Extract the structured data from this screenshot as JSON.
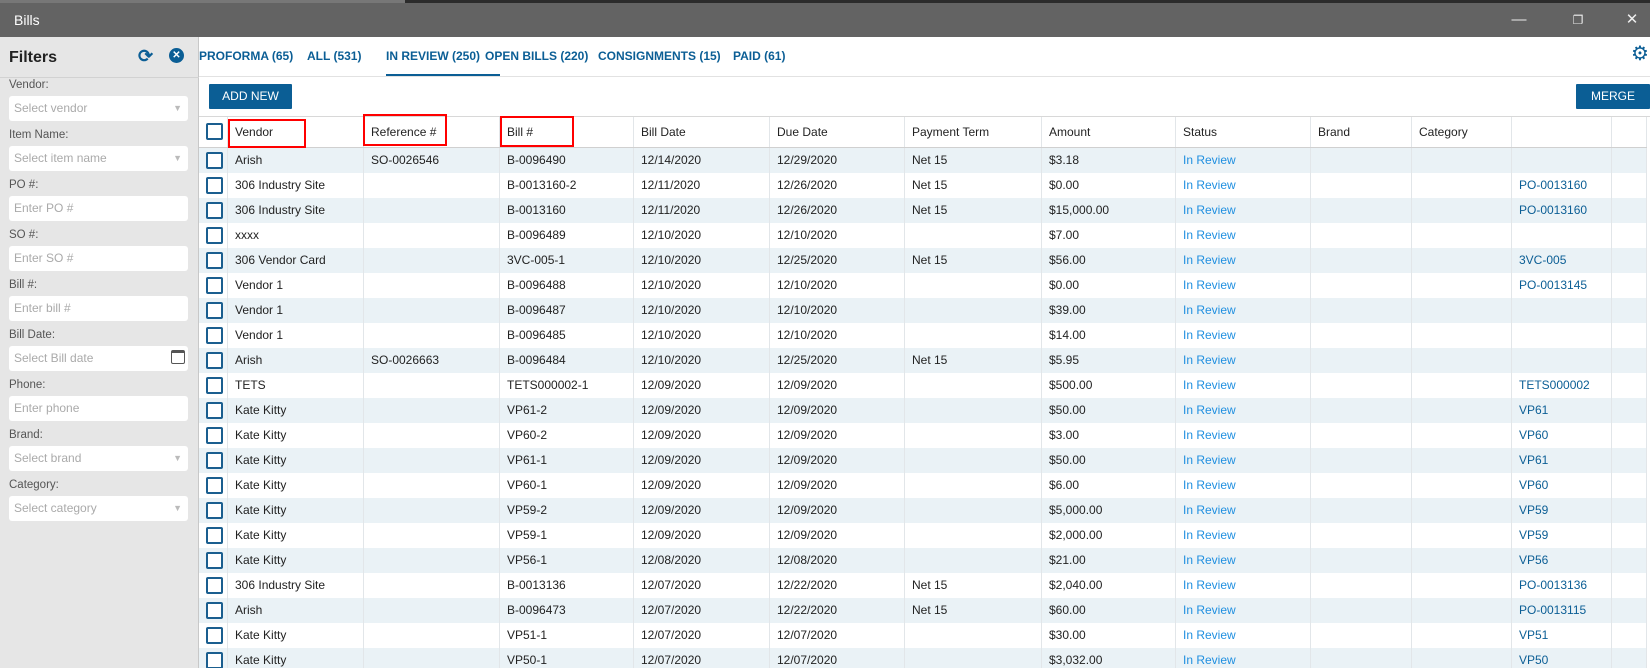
{
  "window": {
    "title": "Bills",
    "minimize": "—",
    "restore": "❐",
    "close": "✕"
  },
  "filters": {
    "title": "Filters",
    "refresh_icon": "⟳",
    "clear_icon": "✕",
    "fields": [
      {
        "label": "Vendor:",
        "placeholder": "Select vendor",
        "type": "select"
      },
      {
        "label": "Item Name:",
        "placeholder": "Select item name",
        "type": "select"
      },
      {
        "label": "PO #:",
        "placeholder": "Enter PO #",
        "type": "text"
      },
      {
        "label": "SO #:",
        "placeholder": "Enter SO #",
        "type": "text"
      },
      {
        "label": "Bill #:",
        "placeholder": "Enter bill #",
        "type": "text"
      },
      {
        "label": "Bill Date:",
        "placeholder": "Select Bill date",
        "type": "date"
      },
      {
        "label": "Phone:",
        "placeholder": "Enter phone",
        "type": "text"
      },
      {
        "label": "Brand:",
        "placeholder": "Select brand",
        "type": "select"
      },
      {
        "label": "Category:",
        "placeholder": "Select category",
        "type": "select"
      }
    ]
  },
  "tabs": [
    {
      "label": "PROFORMA (65)"
    },
    {
      "label": "ALL (531)"
    },
    {
      "label": "IN REVIEW (250)",
      "active": true
    },
    {
      "label": "OPEN BILLS (220)"
    },
    {
      "label": "CONSIGNMENTS (15)"
    },
    {
      "label": "PAID (61)"
    }
  ],
  "toolbar": {
    "add_new": "ADD NEW",
    "merge": "MERGE",
    "settings_icon": "⚙"
  },
  "table": {
    "headers": [
      "Vendor",
      "Reference #",
      "Bill #",
      "Bill Date",
      "Due Date",
      "Payment Term",
      "Amount",
      "Status",
      "Brand",
      "Category",
      "",
      ""
    ],
    "rows": [
      [
        "Arish",
        "SO-0026546",
        "B-0096490",
        "12/14/2020",
        "12/29/2020",
        "Net 15",
        "$3.18",
        "In Review",
        "",
        "",
        ""
      ],
      [
        "306 Industry Site",
        "",
        "B-0013160-2",
        "12/11/2020",
        "12/26/2020",
        "Net 15",
        "$0.00",
        "In Review",
        "",
        "",
        "PO-0013160"
      ],
      [
        "306 Industry Site",
        "",
        "B-0013160",
        "12/11/2020",
        "12/26/2020",
        "Net 15",
        "$15,000.00",
        "In Review",
        "",
        "",
        "PO-0013160"
      ],
      [
        "xxxx",
        "",
        "B-0096489",
        "12/10/2020",
        "12/10/2020",
        "",
        "$7.00",
        "In Review",
        "",
        "",
        ""
      ],
      [
        "306 Vendor Card",
        "",
        "3VC-005-1",
        "12/10/2020",
        "12/25/2020",
        "Net 15",
        "$56.00",
        "In Review",
        "",
        "",
        "3VC-005"
      ],
      [
        "Vendor 1",
        "",
        "B-0096488",
        "12/10/2020",
        "12/10/2020",
        "",
        "$0.00",
        "In Review",
        "",
        "",
        "PO-0013145"
      ],
      [
        "Vendor 1",
        "",
        "B-0096487",
        "12/10/2020",
        "12/10/2020",
        "",
        "$39.00",
        "In Review",
        "",
        "",
        ""
      ],
      [
        "Vendor 1",
        "",
        "B-0096485",
        "12/10/2020",
        "12/10/2020",
        "",
        "$14.00",
        "In Review",
        "",
        "",
        ""
      ],
      [
        "Arish",
        "SO-0026663",
        "B-0096484",
        "12/10/2020",
        "12/25/2020",
        "Net 15",
        "$5.95",
        "In Review",
        "",
        "",
        ""
      ],
      [
        "TETS",
        "",
        "TETS000002-1",
        "12/09/2020",
        "12/09/2020",
        "",
        "$500.00",
        "In Review",
        "",
        "",
        "TETS000002"
      ],
      [
        "Kate Kitty",
        "",
        "VP61-2",
        "12/09/2020",
        "12/09/2020",
        "",
        "$50.00",
        "In Review",
        "",
        "",
        "VP61"
      ],
      [
        "Kate Kitty",
        "",
        "VP60-2",
        "12/09/2020",
        "12/09/2020",
        "",
        "$3.00",
        "In Review",
        "",
        "",
        "VP60"
      ],
      [
        "Kate Kitty",
        "",
        "VP61-1",
        "12/09/2020",
        "12/09/2020",
        "",
        "$50.00",
        "In Review",
        "",
        "",
        "VP61"
      ],
      [
        "Kate Kitty",
        "",
        "VP60-1",
        "12/09/2020",
        "12/09/2020",
        "",
        "$6.00",
        "In Review",
        "",
        "",
        "VP60"
      ],
      [
        "Kate Kitty",
        "",
        "VP59-2",
        "12/09/2020",
        "12/09/2020",
        "",
        "$5,000.00",
        "In Review",
        "",
        "",
        "VP59"
      ],
      [
        "Kate Kitty",
        "",
        "VP59-1",
        "12/09/2020",
        "12/09/2020",
        "",
        "$2,000.00",
        "In Review",
        "",
        "",
        "VP59"
      ],
      [
        "Kate Kitty",
        "",
        "VP56-1",
        "12/08/2020",
        "12/08/2020",
        "",
        "$21.00",
        "In Review",
        "",
        "",
        "VP56"
      ],
      [
        "306 Industry Site",
        "",
        "B-0013136",
        "12/07/2020",
        "12/22/2020",
        "Net 15",
        "$2,040.00",
        "In Review",
        "",
        "",
        "PO-0013136"
      ],
      [
        "Arish",
        "",
        "B-0096473",
        "12/07/2020",
        "12/22/2020",
        "Net 15",
        "$60.00",
        "In Review",
        "",
        "",
        "PO-0013115"
      ],
      [
        "Kate Kitty",
        "",
        "VP51-1",
        "12/07/2020",
        "12/07/2020",
        "",
        "$30.00",
        "In Review",
        "",
        "",
        "VP51"
      ],
      [
        "Kate Kitty",
        "",
        "VP50-1",
        "12/07/2020",
        "12/07/2020",
        "",
        "$3,032.00",
        "In Review",
        "",
        "",
        "VP50"
      ]
    ]
  },
  "colors": {
    "accent": "#0b5e95",
    "status": "#1f8fe0",
    "row_alt": "#eaf2f6",
    "highlight": "#ff0000"
  }
}
